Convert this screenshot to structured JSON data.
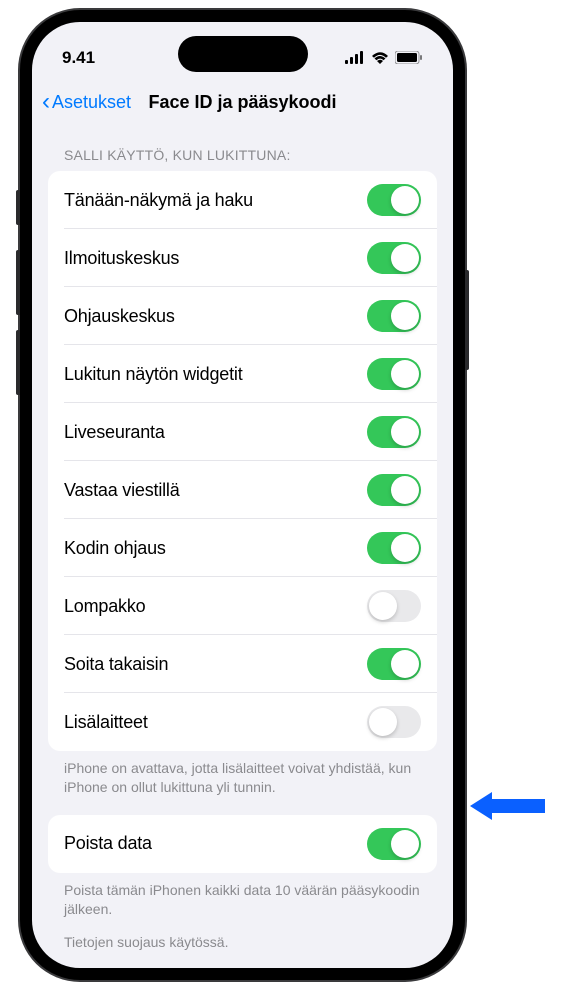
{
  "status": {
    "time": "9.41"
  },
  "nav": {
    "back_label": "Asetukset",
    "title": "Face ID ja pääsykoodi"
  },
  "sections": {
    "allow_access_header": "SALLI KÄYTTÖ, KUN LUKITTUNA:",
    "allow_access_items": [
      {
        "label": "Tänään-näkymä ja haku",
        "on": true
      },
      {
        "label": "Ilmoituskeskus",
        "on": true
      },
      {
        "label": "Ohjauskeskus",
        "on": true
      },
      {
        "label": "Lukitun näytön widgetit",
        "on": true
      },
      {
        "label": "Liveseuranta",
        "on": true
      },
      {
        "label": "Vastaa viestillä",
        "on": true
      },
      {
        "label": "Kodin ohjaus",
        "on": true
      },
      {
        "label": "Lompakko",
        "on": false
      },
      {
        "label": "Soita takaisin",
        "on": true
      },
      {
        "label": "Lisälaitteet",
        "on": false
      }
    ],
    "accessories_footer": "iPhone on avattava, jotta lisälaitteet voivat yhdistää, kun iPhone on ollut lukittuna yli tunnin.",
    "erase_data": {
      "label": "Poista data",
      "on": true
    },
    "erase_footer": "Poista tämän iPhonen kaikki data 10 väärän pääsykoodin jälkeen.",
    "data_protection_footer": "Tietojen suojaus käytössä."
  }
}
